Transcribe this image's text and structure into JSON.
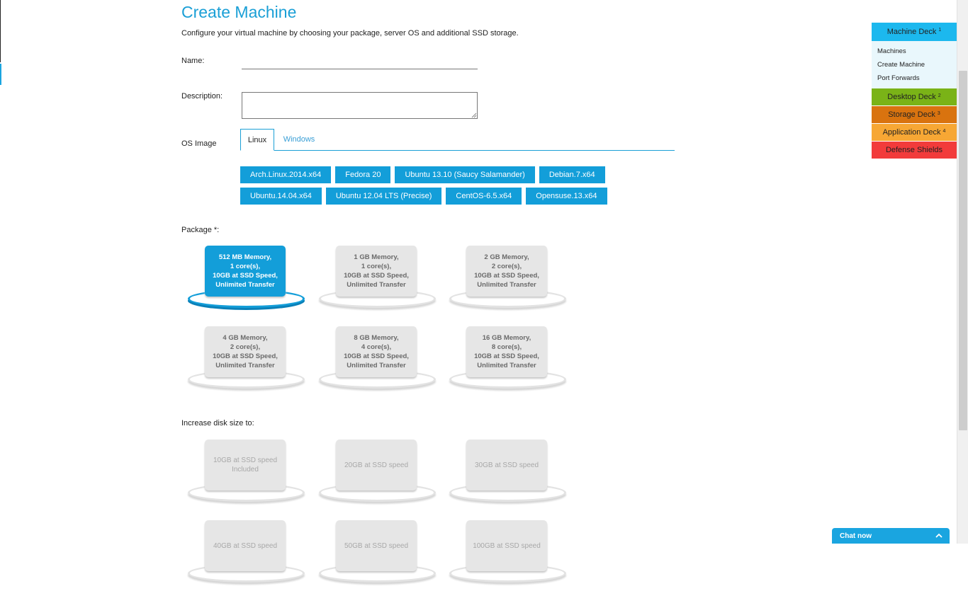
{
  "page": {
    "title": "Create Machine",
    "subtitle": "Configure your virtual machine by choosing your package, server OS and additional SSD storage."
  },
  "form": {
    "name_label": "Name:",
    "name_value": "",
    "description_label": "Description:",
    "description_value": "",
    "os_label": "OS Image",
    "package_label": "Package *:",
    "disk_label": "Increase disk size to:"
  },
  "os_tabs": [
    {
      "label": "Linux",
      "active": true
    },
    {
      "label": "Windows",
      "active": false
    }
  ],
  "os_images_row1": [
    "Arch.Linux.2014.x64",
    "Fedora 20",
    "Ubuntu 13.10 (Saucy Salamander)",
    "Debian.7.x64"
  ],
  "os_images_row2": [
    "Ubuntu.14.04.x64",
    "Ubuntu 12.04 LTS (Precise)",
    "CentOS-6.5.x64",
    "Opensuse.13.x64"
  ],
  "packages": [
    {
      "text": "512 MB Memory,\n1 core(s),\n10GB at SSD Speed,\nUnlimited Transfer",
      "selected": true
    },
    {
      "text": "1 GB Memory,\n1 core(s),\n10GB at SSD Speed,\nUnlimited Transfer",
      "selected": false
    },
    {
      "text": "2 GB Memory,\n2 core(s),\n10GB at SSD Speed,\nUnlimited Transfer",
      "selected": false
    },
    {
      "text": "4 GB Memory,\n2 core(s),\n10GB at SSD Speed,\nUnlimited Transfer",
      "selected": false
    },
    {
      "text": "8 GB Memory,\n4 core(s),\n10GB at SSD Speed,\nUnlimited Transfer",
      "selected": false
    },
    {
      "text": "16 GB Memory,\n8 core(s),\n10GB at SSD Speed,\nUnlimited Transfer",
      "selected": false
    }
  ],
  "disks": [
    {
      "text": "10GB at SSD speed\nIncluded"
    },
    {
      "text": "20GB at SSD speed"
    },
    {
      "text": "30GB at SSD speed"
    },
    {
      "text": "40GB at SSD speed"
    },
    {
      "text": "50GB at SSD speed"
    },
    {
      "text": "100GB at SSD speed"
    }
  ],
  "sidebar": {
    "machine_deck": {
      "label": "Machine Deck",
      "marker": "1"
    },
    "machine_items": [
      "Machines",
      "Create Machine",
      "Port Forwards"
    ],
    "decks": [
      {
        "label": "Desktop Deck",
        "marker": "2",
        "color": "#7ab317"
      },
      {
        "label": "Storage Deck",
        "marker": "3",
        "color": "#d9730f"
      },
      {
        "label": "Application Deck",
        "marker": "4",
        "color": "#f7a734"
      },
      {
        "label": "Defense Shields",
        "marker": "",
        "color": "#f23b3b"
      }
    ]
  },
  "chat": {
    "label": "Chat now",
    "icon": "chevron-up-icon"
  },
  "colors": {
    "accent": "#139ed9",
    "sidebar_head": "#1cb8ee"
  }
}
